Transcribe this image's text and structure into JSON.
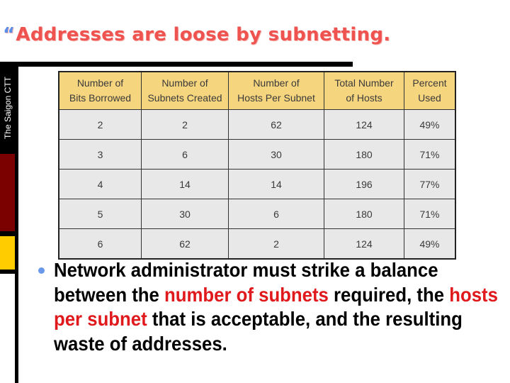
{
  "slide": {
    "title_quote": "“",
    "title": "Addresses are loose by subnetting.",
    "sidebar_label": "The Saigon CTT",
    "colors": {
      "title": "#ef5350",
      "quote": "#5b8ee6",
      "sidebar_dark": "#7b0000",
      "sidebar_gold": "#ffcc00",
      "table_header": "#f6d57f",
      "table_cell": "#e8e8e8",
      "highlight": "#e0191c",
      "bullet": "#6a98ea"
    }
  },
  "table": {
    "headers": [
      [
        "Number of",
        "Bits Borrowed"
      ],
      [
        "Number of",
        "Subnets Created"
      ],
      [
        "Number of",
        "Hosts Per Subnet"
      ],
      [
        "Total Number",
        "of Hosts"
      ],
      [
        "Percent",
        "Used"
      ]
    ],
    "rows": [
      [
        "2",
        "2",
        "62",
        "124",
        "49%"
      ],
      [
        "3",
        "6",
        "30",
        "180",
        "71%"
      ],
      [
        "4",
        "14",
        "14",
        "196",
        "77%"
      ],
      [
        "5",
        "30",
        "6",
        "180",
        "71%"
      ],
      [
        "6",
        "62",
        "2",
        "124",
        "49%"
      ]
    ]
  },
  "bullet": {
    "segments": [
      {
        "text": "Network administrator must strike a balance between the ",
        "highlight": false
      },
      {
        "text": "number of subnets",
        "highlight": true
      },
      {
        "text": " required, the ",
        "highlight": false
      },
      {
        "text": "hosts per subnet",
        "highlight": true
      },
      {
        "text": " that is acceptable, and the resulting waste of addresses.",
        "highlight": false
      }
    ]
  }
}
